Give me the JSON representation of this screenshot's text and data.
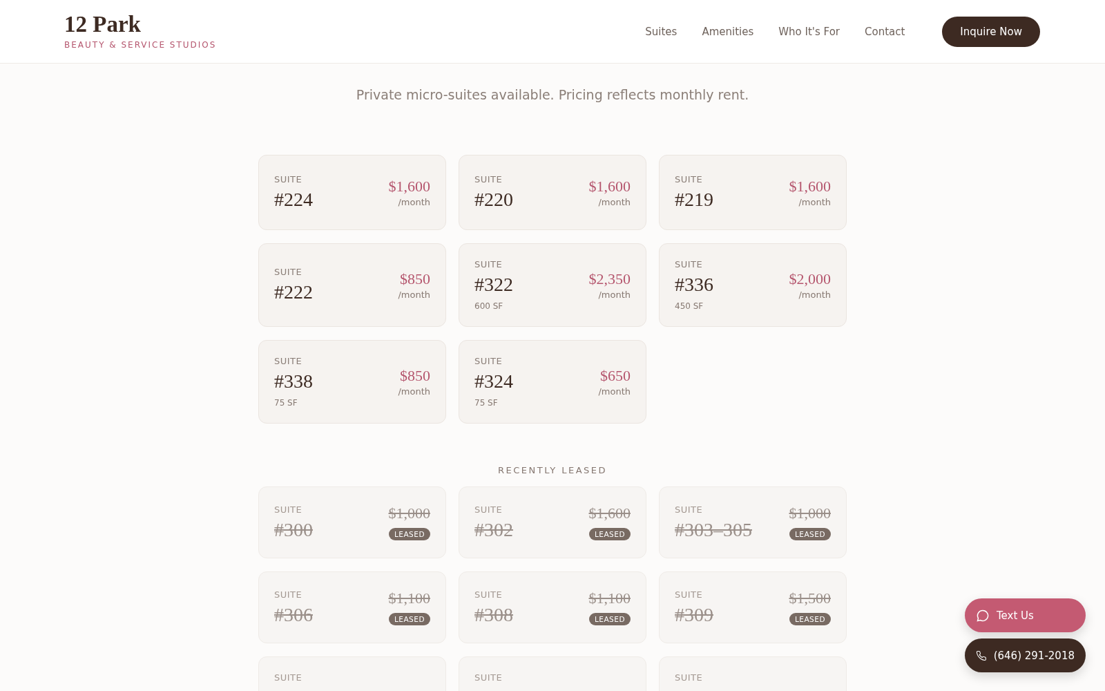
{
  "header": {
    "logo": "12 Park",
    "tagline": "BEAUTY & SERVICE STUDIOS",
    "nav": [
      "Suites",
      "Amenities",
      "Who It's For",
      "Contact"
    ],
    "cta": "Inquire Now"
  },
  "hero": {
    "subtitle": "Private micro-suites available. Pricing reflects monthly rent."
  },
  "available": [
    {
      "label": "SUITE",
      "number": "#224",
      "price": "$1,600",
      "period": "/month",
      "leased": false
    },
    {
      "label": "SUITE",
      "number": "#220",
      "price": "$1,600",
      "period": "/month",
      "leased": false
    },
    {
      "label": "SUITE",
      "number": "#219",
      "price": "$1,600",
      "period": "/month",
      "leased": false
    },
    {
      "label": "SUITE",
      "number": "#222",
      "price": "$850",
      "period": "/month",
      "leased": false
    },
    {
      "label": "SUITE",
      "number": "#322",
      "size": "600 SF",
      "price": "$2,350",
      "period": "/month",
      "leased": false
    },
    {
      "label": "SUITE",
      "number": "#336",
      "size": "450 SF",
      "price": "$2,000",
      "period": "/month",
      "leased": false
    },
    {
      "label": "SUITE",
      "number": "#338",
      "size": "75 SF",
      "price": "$850",
      "period": "/month",
      "leased": false
    },
    {
      "label": "SUITE",
      "number": "#324",
      "size": "75 SF",
      "price": "$650",
      "period": "/month",
      "leased": false
    }
  ],
  "recently_leased": {
    "heading": "RECENTLY LEASED",
    "suites": [
      {
        "label": "SUITE",
        "number": "#300",
        "price": "$1,000",
        "badge": "LEASED",
        "leased": true
      },
      {
        "label": "SUITE",
        "number": "#302",
        "price": "$1,600",
        "badge": "LEASED",
        "leased": true
      },
      {
        "label": "SUITE",
        "number": "#303–305",
        "price": "$1,000",
        "badge": "LEASED",
        "leased": true
      },
      {
        "label": "SUITE",
        "number": "#306",
        "price": "$1,100",
        "badge": "LEASED",
        "leased": true
      },
      {
        "label": "SUITE",
        "number": "#308",
        "price": "$1,100",
        "badge": "LEASED",
        "leased": true
      },
      {
        "label": "SUITE",
        "number": "#309",
        "price": "$1,500",
        "badge": "LEASED",
        "leased": true
      },
      {
        "label": "SUITE",
        "leased": true
      },
      {
        "label": "SUITE",
        "leased": true
      },
      {
        "label": "SUITE",
        "leased": true
      }
    ]
  },
  "floating": {
    "text_button": "Text Us",
    "phone_button": "(646) 291-2018"
  }
}
